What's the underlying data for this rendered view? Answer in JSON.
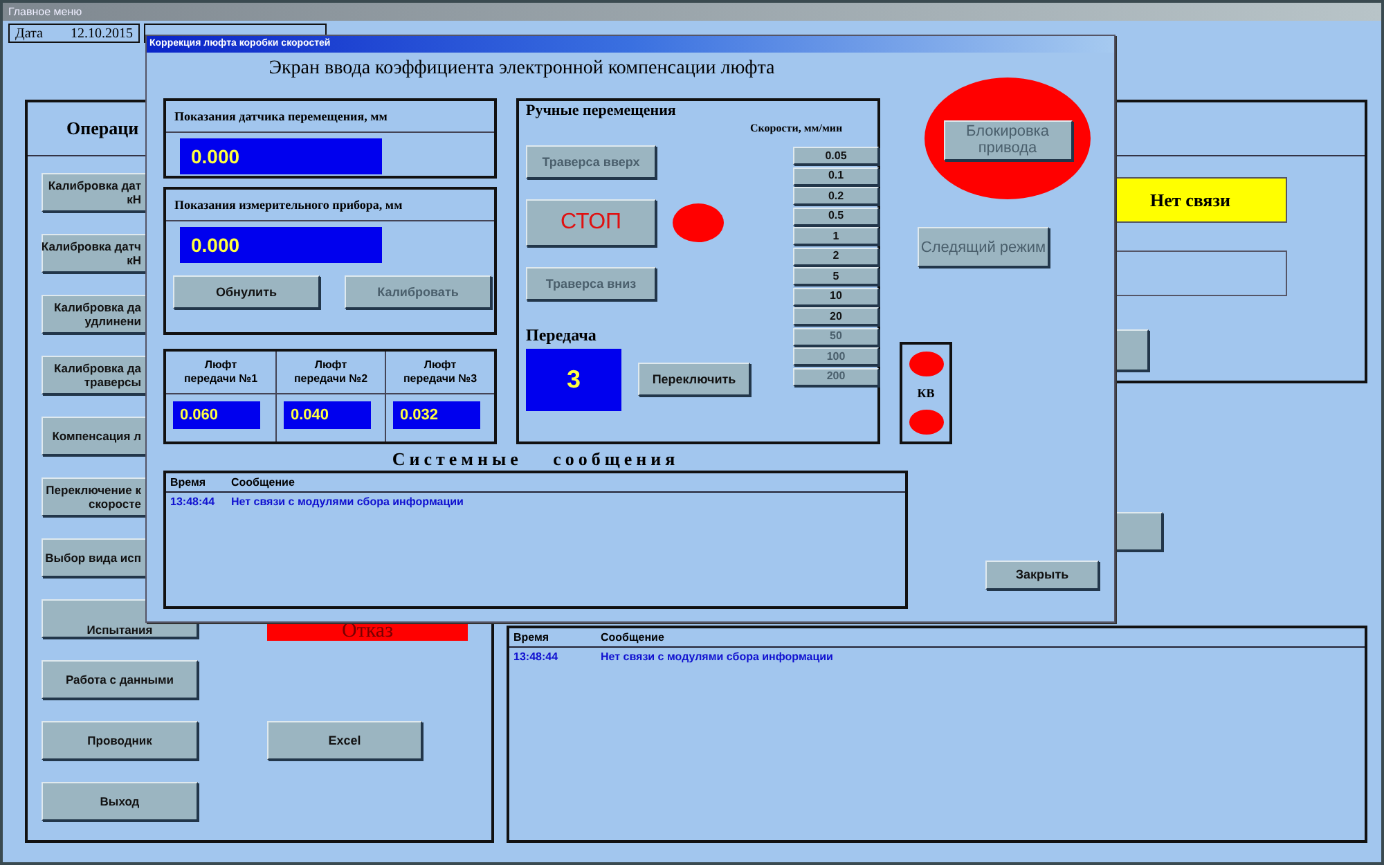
{
  "main_window": {
    "title": "Главное меню",
    "date_label": "Дата",
    "date": "12.10.2015",
    "operations_title": "Операци",
    "operation_buttons": [
      {
        "label": "Калибровка дат\nкН"
      },
      {
        "label": "Калибровка датч\nкН"
      },
      {
        "label": "Калибровка да\nудлинени"
      },
      {
        "label": "Калибровка да\nтраверсы"
      },
      {
        "label": "Компенсация л"
      },
      {
        "label": "Переключение к\nскоросте"
      },
      {
        "label": "Выбор вида исп"
      },
      {
        "label": "Испытания"
      },
      {
        "label": "Работа с данными"
      },
      {
        "label": "Проводник"
      },
      {
        "label": "Выход"
      }
    ],
    "failure_label": "Отказ",
    "excel_button": "Excel",
    "connection_status": "Нет связи",
    "messages": {
      "columns": [
        "Время",
        "Сообщение"
      ],
      "rows": [
        {
          "time": "13:48:44",
          "message": "Нет связи с модулями сбора информации"
        }
      ]
    }
  },
  "dialog": {
    "title": "Коррекция люфта коробки скоростей",
    "heading": "Экран ввода коэффициента электронной компенсации люфта",
    "displacement_sensor": {
      "label": "Показания датчика перемещения, мм",
      "value": "0.000"
    },
    "measuring_device": {
      "label": "Показания измерительного прибора, мм",
      "value": "0.000"
    },
    "device_buttons": [
      {
        "label": "Обнулить",
        "disabled": false
      },
      {
        "label": "Калибровать",
        "disabled": true
      }
    ],
    "backlash": [
      {
        "label": "Люфт\nпередачи №1",
        "value": "0.060"
      },
      {
        "label": "Люфт\nпередачи №2",
        "value": "0.040"
      },
      {
        "label": "Люфт\nпередачи №3",
        "value": "0.032"
      }
    ],
    "manual": {
      "title": "Ручные перемещения",
      "speeds_label": "Скорости, мм/мин",
      "up_button": {
        "label": "Траверса вверх",
        "disabled": true
      },
      "stop_button": {
        "label": "СТОП",
        "disabled": false
      },
      "down_button": {
        "label": "Траверса вниз",
        "disabled": true
      },
      "gear_label": "Передача",
      "gear": "3",
      "switch_button": "Переключить",
      "speeds": [
        {
          "label": "0.05",
          "disabled": false
        },
        {
          "label": "0.1",
          "disabled": false
        },
        {
          "label": "0.2",
          "disabled": false
        },
        {
          "label": "0.5",
          "disabled": false
        },
        {
          "label": "1",
          "disabled": false
        },
        {
          "label": "2",
          "disabled": false
        },
        {
          "label": "5",
          "disabled": false
        },
        {
          "label": "10",
          "disabled": false
        },
        {
          "label": "20",
          "disabled": false
        },
        {
          "label": "50",
          "disabled": true
        },
        {
          "label": "100",
          "disabled": true
        },
        {
          "label": "200",
          "disabled": true
        }
      ]
    },
    "lock_button": {
      "label": "Блокировка\nпривода",
      "disabled": true
    },
    "tracking_button": {
      "label": "Следящий режим",
      "disabled": true
    },
    "limit_label": "КВ",
    "messages_title": "Системные сообщения",
    "messages": {
      "columns": [
        "Время",
        "Сообщение"
      ],
      "rows": [
        {
          "time": "13:48:44",
          "message": "Нет связи с модулями сбора информации"
        }
      ]
    },
    "close_button": "Закрыть"
  }
}
